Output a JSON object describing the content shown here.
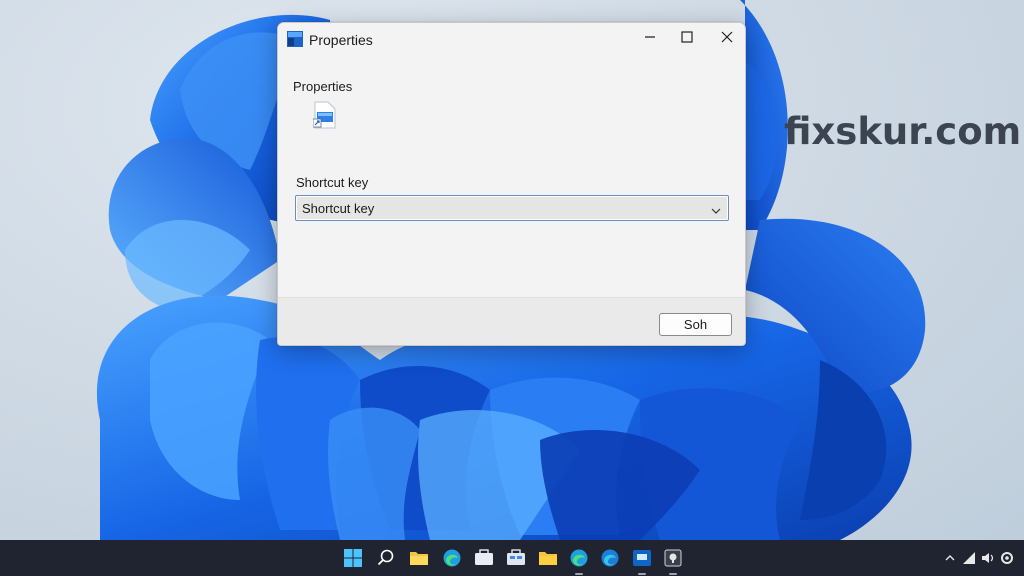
{
  "watermark": "fixskur.com",
  "window": {
    "title": "Properties",
    "section_label": "Properties",
    "shortcut_label": "Shortcut key",
    "shortcut_value": "Shortcut key",
    "ok_label": "Soh"
  },
  "window_controls": {
    "minimize_icon": "minimize-icon",
    "maximize_icon": "maximize-icon",
    "close_icon": "close-icon"
  },
  "taskbar": {
    "icons": [
      "windows-start-icon",
      "search-icon",
      "file-explorer-icon",
      "edge-icon",
      "folder-icon",
      "store-icon",
      "folder-icon",
      "edge-icon",
      "edge-icon",
      "app-icon",
      "app-icon"
    ],
    "tray_icons": [
      "chevron-up-icon",
      "network-icon",
      "speaker-icon",
      "settings-icon"
    ]
  },
  "colors": {
    "wallpaper_blue": "#1a5fd6",
    "taskbar": "#1f2430",
    "window_bg": "#f3f3f3",
    "dropdown_border": "#6a8fbf"
  }
}
